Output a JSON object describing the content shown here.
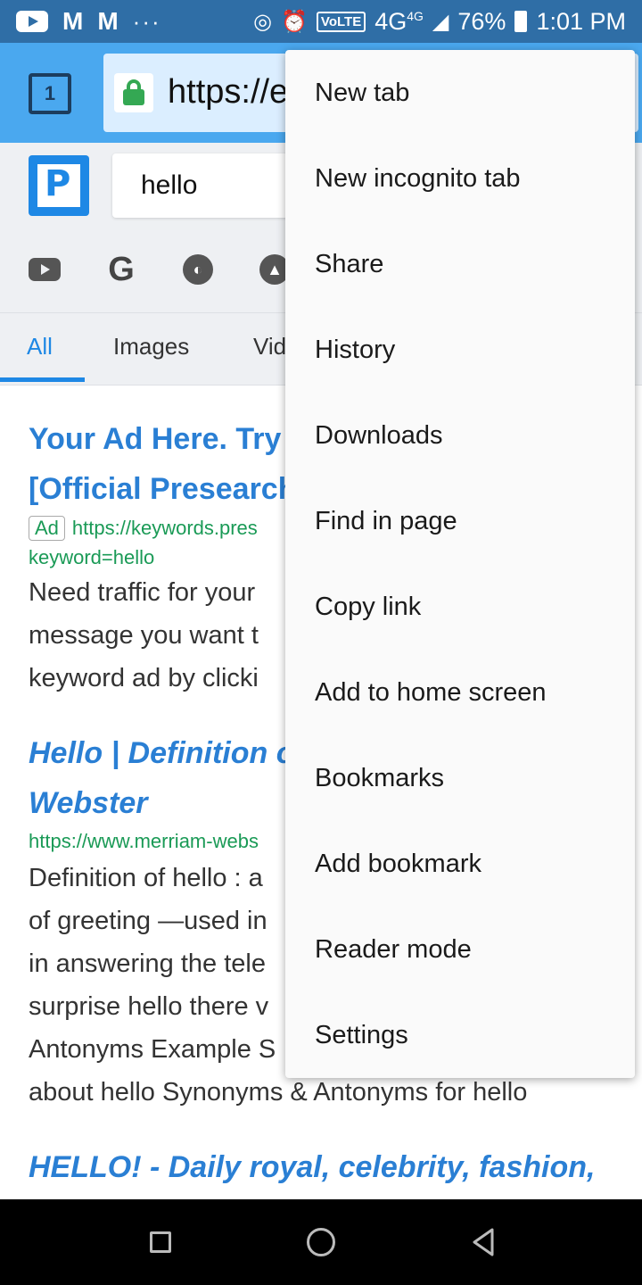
{
  "status_bar": {
    "time": "1:01 PM",
    "battery": "76%",
    "network": "4G",
    "network_super": "4G",
    "volte": "VoLTE",
    "dots": "···",
    "gmail_1": "M",
    "gmail_2": "M",
    "icons": [
      "youtube-icon",
      "gmail-icon",
      "gmail-outline-icon",
      "hotspot-icon",
      "alarm-icon",
      "signal-icon",
      "battery-icon"
    ]
  },
  "browser": {
    "tab_count": "1",
    "url": "https://e"
  },
  "search": {
    "query": "hello",
    "engines": [
      "youtube-icon",
      "google-icon",
      "duckduckgo-icon",
      "chart-icon"
    ]
  },
  "tabs": [
    {
      "label": "All",
      "active": true
    },
    {
      "label": "Images",
      "active": false
    },
    {
      "label": "Vid",
      "active": false
    }
  ],
  "results": {
    "ad": {
      "title_line1": "Your Ad Here. Try",
      "title_line2": "[Official Presearch",
      "badge": "Ad",
      "url_line1": "https://keywords.pres",
      "url_line2": "keyword=hello",
      "snippet": [
        "Need traffic for your",
        "message you want t",
        "keyword ad by clicki"
      ]
    },
    "result2": {
      "title_line1": "Hello | Definition o",
      "title_line2": "Webster",
      "url": "https://www.merriam-webs",
      "snippet": [
        "Definition of hello : a",
        "of greeting —used in",
        "in answering the tele",
        "surprise hello there v",
        "Antonyms Example S",
        "about hello Synonyms & Antonyms for hello"
      ]
    },
    "result3": {
      "title": "HELLO! - Daily royal, celebrity, fashion,"
    }
  },
  "menu": {
    "items": [
      "New tab",
      "New incognito tab",
      "Share",
      "History",
      "Downloads",
      "Find in page",
      "Copy link",
      "Add to home screen",
      "Bookmarks",
      "Add bookmark",
      "Reader mode",
      "Settings"
    ]
  }
}
